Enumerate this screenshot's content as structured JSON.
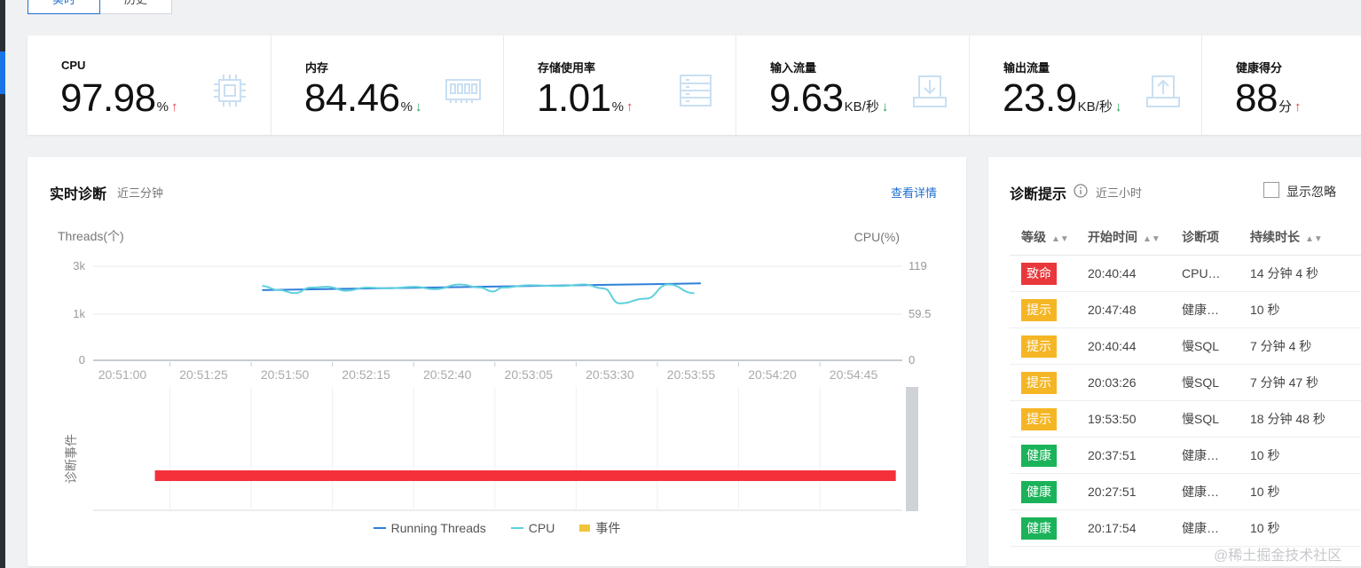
{
  "tabs": [
    {
      "label": "实时",
      "active": true
    },
    {
      "label": "历史",
      "active": false
    }
  ],
  "metrics": [
    {
      "label": "CPU",
      "value": "97.98",
      "unit": "%",
      "trend": "up",
      "arrow": "↑",
      "icon": "cpu-chip-icon"
    },
    {
      "label": "内存",
      "value": "84.46",
      "unit": "%",
      "trend": "down",
      "arrow": "↓",
      "icon": "memory-module-icon"
    },
    {
      "label": "存储使用率",
      "value": "1.01",
      "unit": "%",
      "trend": "up",
      "arrow": "↑",
      "icon": "storage-list-icon"
    },
    {
      "label": "输入流量",
      "value": "9.63",
      "unit": "KB/秒",
      "trend": "down",
      "arrow": "↓",
      "icon": "download-tray-icon"
    },
    {
      "label": "输出流量",
      "value": "23.9",
      "unit": "KB/秒",
      "trend": "down",
      "arrow": "↓",
      "icon": "upload-tray-icon"
    },
    {
      "label": "健康得分",
      "value": "88",
      "unit": "分",
      "trend": "up",
      "arrow": "↑",
      "icon": ""
    }
  ],
  "colors": {
    "accent": "#1f6fd0",
    "up": "#e0393e",
    "down": "#1aa34a",
    "fatal": "#e8383b",
    "warn": "#f5b625",
    "healthy": "#1bb35a",
    "threads_line": "#2e7fd9",
    "cpu_line": "#5fd0dd",
    "event_bar": "#f5303a",
    "event_legend": "#f0c43c",
    "icon": "#c9dff3"
  },
  "diagnosis": {
    "title": "实时诊断",
    "subtitle": "近三分钟",
    "detail_link": "查看详情",
    "event_axis_label": "诊断事件"
  },
  "chart_data": {
    "type": "line",
    "title": "",
    "y_left_label": "Threads(个)",
    "y_right_label": "CPU(%)",
    "y_left_ticks": [
      "3k",
      "1k",
      "0"
    ],
    "y_left_range": [
      0,
      3000
    ],
    "y_right_ticks": [
      "119",
      "59.5",
      "0"
    ],
    "y_right_range": [
      0,
      119
    ],
    "x_ticks": [
      "20:51:00",
      "20:51:25",
      "20:51:50",
      "20:52:15",
      "20:52:40",
      "20:53:05",
      "20:53:30",
      "20:53:55",
      "20:54:20",
      "20:54:45"
    ],
    "series": [
      {
        "name": "Running Threads",
        "axis": "left",
        "x": [
          "20:51:43",
          "20:53:58"
        ],
        "values": [
          2310,
          2530
        ]
      },
      {
        "name": "CPU",
        "axis": "right",
        "x": [
          "20:51:43",
          "20:51:48",
          "20:51:53",
          "20:51:58",
          "20:52:03",
          "20:52:09",
          "20:52:15",
          "20:52:22",
          "20:52:30",
          "20:52:36",
          "20:52:44",
          "20:52:50",
          "20:52:54",
          "20:52:57",
          "20:53:05",
          "20:53:15",
          "20:53:22",
          "20:53:28",
          "20:53:33",
          "20:53:41",
          "20:53:48",
          "20:53:56"
        ],
        "values": [
          94,
          89,
          85,
          92,
          93,
          88,
          92,
          91,
          93,
          90,
          96,
          92,
          87,
          92,
          95,
          94,
          96,
          91,
          72,
          78,
          96,
          85
        ]
      }
    ],
    "events": [
      {
        "name": "事件",
        "start": "20:51:10",
        "end": "20:54:58"
      }
    ],
    "legend": [
      "Running Threads",
      "CPU",
      "事件"
    ],
    "legend_position": "bottom",
    "grid": true
  },
  "hints": {
    "title": "诊断提示",
    "info_icon": "info-circle-icon",
    "subtitle": "近三小时",
    "show_ignored_label": "显示忽略",
    "show_ignored_checked": false,
    "columns": [
      "等级",
      "开始时间",
      "诊断项",
      "持续时长"
    ],
    "rows": [
      {
        "level": "致命",
        "level_type": "fatal",
        "start": "20:40:44",
        "item": "CPU…",
        "duration": "14 分钟 4 秒"
      },
      {
        "level": "提示",
        "level_type": "warn",
        "start": "20:47:48",
        "item": "健康…",
        "duration": "10 秒"
      },
      {
        "level": "提示",
        "level_type": "warn",
        "start": "20:40:44",
        "item": "慢SQL",
        "duration": "7 分钟 4 秒"
      },
      {
        "level": "提示",
        "level_type": "warn",
        "start": "20:03:26",
        "item": "慢SQL",
        "duration": "7 分钟 47 秒"
      },
      {
        "level": "提示",
        "level_type": "warn",
        "start": "19:53:50",
        "item": "慢SQL",
        "duration": "18 分钟 48 秒"
      },
      {
        "level": "健康",
        "level_type": "healthy",
        "start": "20:37:51",
        "item": "健康…",
        "duration": "10 秒"
      },
      {
        "level": "健康",
        "level_type": "healthy",
        "start": "20:27:51",
        "item": "健康…",
        "duration": "10 秒"
      },
      {
        "level": "健康",
        "level_type": "healthy",
        "start": "20:17:54",
        "item": "健康…",
        "duration": "10 秒"
      }
    ]
  },
  "watermark": "@稀土掘金技术社区"
}
